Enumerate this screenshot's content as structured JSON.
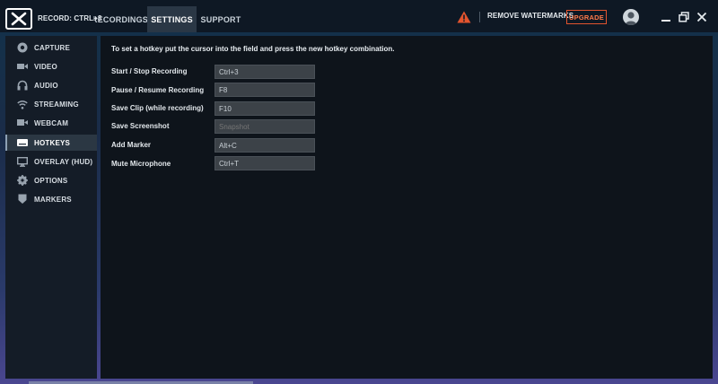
{
  "header": {
    "record_label": "RECORD: CTRL+3",
    "tabs": [
      {
        "label": "RECORDINGS",
        "active": false
      },
      {
        "label": "SETTINGS",
        "active": true
      },
      {
        "label": "SUPPORT",
        "active": false
      }
    ],
    "remove_watermarks": "REMOVE WATERMARKS",
    "upgrade": "UPGRADE",
    "accent_color": "#e3542e",
    "icons": [
      "warning-icon",
      "avatar-icon",
      "minimize-icon",
      "maximize-icon",
      "close-icon"
    ]
  },
  "sidebar": {
    "items": [
      {
        "label": "CAPTURE",
        "icon": "capture-icon",
        "active": false
      },
      {
        "label": "VIDEO",
        "icon": "video-camera-icon",
        "active": false
      },
      {
        "label": "AUDIO",
        "icon": "headphones-icon",
        "active": false
      },
      {
        "label": "STREAMING",
        "icon": "wifi-icon",
        "active": false
      },
      {
        "label": "WEBCAM",
        "icon": "webcam-icon",
        "active": false
      },
      {
        "label": "HOTKEYS",
        "icon": "keyboard-icon",
        "active": true
      },
      {
        "label": "OVERLAY (HUD)",
        "icon": "monitor-icon",
        "active": false
      },
      {
        "label": "OPTIONS",
        "icon": "gear-icon",
        "active": false
      },
      {
        "label": "MARKERS",
        "icon": "marker-icon",
        "active": false
      }
    ]
  },
  "main": {
    "hint": "To set a hotkey put the cursor into the field and press the new hotkey combination.",
    "hotkeys": [
      {
        "label": "Start / Stop Recording",
        "value": "Ctrl+3",
        "placeholder": ""
      },
      {
        "label": "Pause / Resume Recording",
        "value": "F8",
        "placeholder": ""
      },
      {
        "label": "Save Clip (while recording)",
        "value": "F10",
        "placeholder": ""
      },
      {
        "label": "Save Screenshot",
        "value": "",
        "placeholder": "Snapshot"
      },
      {
        "label": "Add Marker",
        "value": "Alt+C",
        "placeholder": ""
      },
      {
        "label": "Mute Microphone",
        "value": "Ctrl+T",
        "placeholder": ""
      }
    ]
  }
}
